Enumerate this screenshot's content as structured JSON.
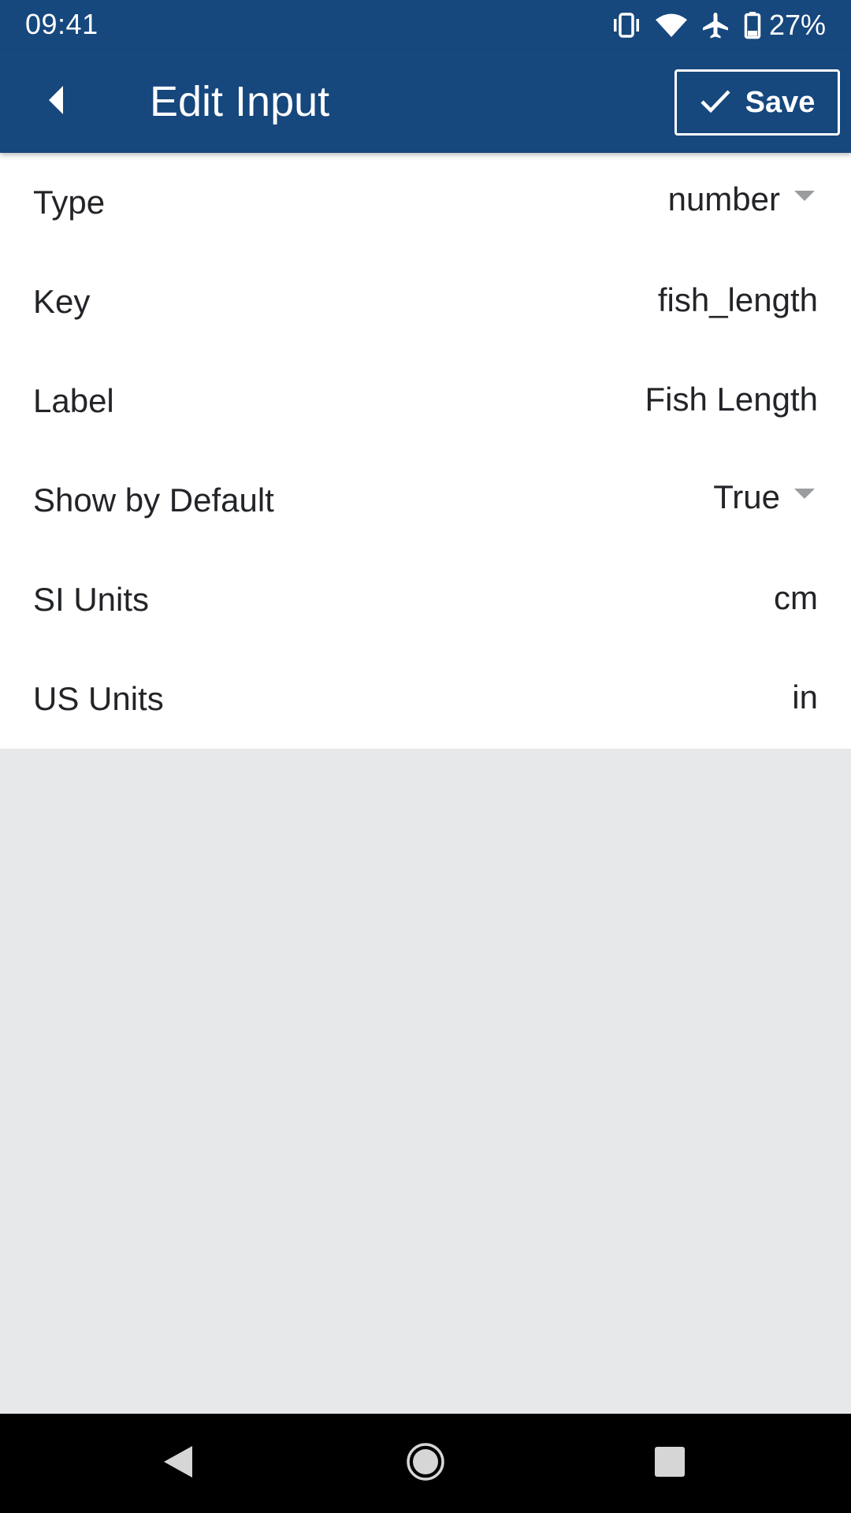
{
  "status_bar": {
    "time": "09:41",
    "battery_percent": "27%",
    "icons": [
      "vibrate-icon",
      "wifi-icon",
      "airplane-icon",
      "battery-icon"
    ]
  },
  "app_bar": {
    "title": "Edit Input",
    "save_label": "Save",
    "back_icon": "back-arrow-icon",
    "save_icon": "check-icon"
  },
  "form": {
    "type": {
      "label": "Type",
      "value": "number"
    },
    "key": {
      "label": "Key",
      "value": "fish_length"
    },
    "field_label": {
      "label": "Label",
      "value": "Fish Length"
    },
    "show_by_default": {
      "label": "Show by Default",
      "value": "True"
    },
    "si_units": {
      "label": "SI Units",
      "value": "cm"
    },
    "us_units": {
      "label": "US Units",
      "value": "in"
    }
  },
  "nav_bar": {
    "buttons": [
      "nav-back-icon",
      "nav-home-icon",
      "nav-recents-icon"
    ]
  },
  "colors": {
    "primary": "#16477d",
    "background": "#e7e8ea",
    "card": "#ffffff",
    "text": "#222428",
    "caret": "#9a9ca0"
  }
}
